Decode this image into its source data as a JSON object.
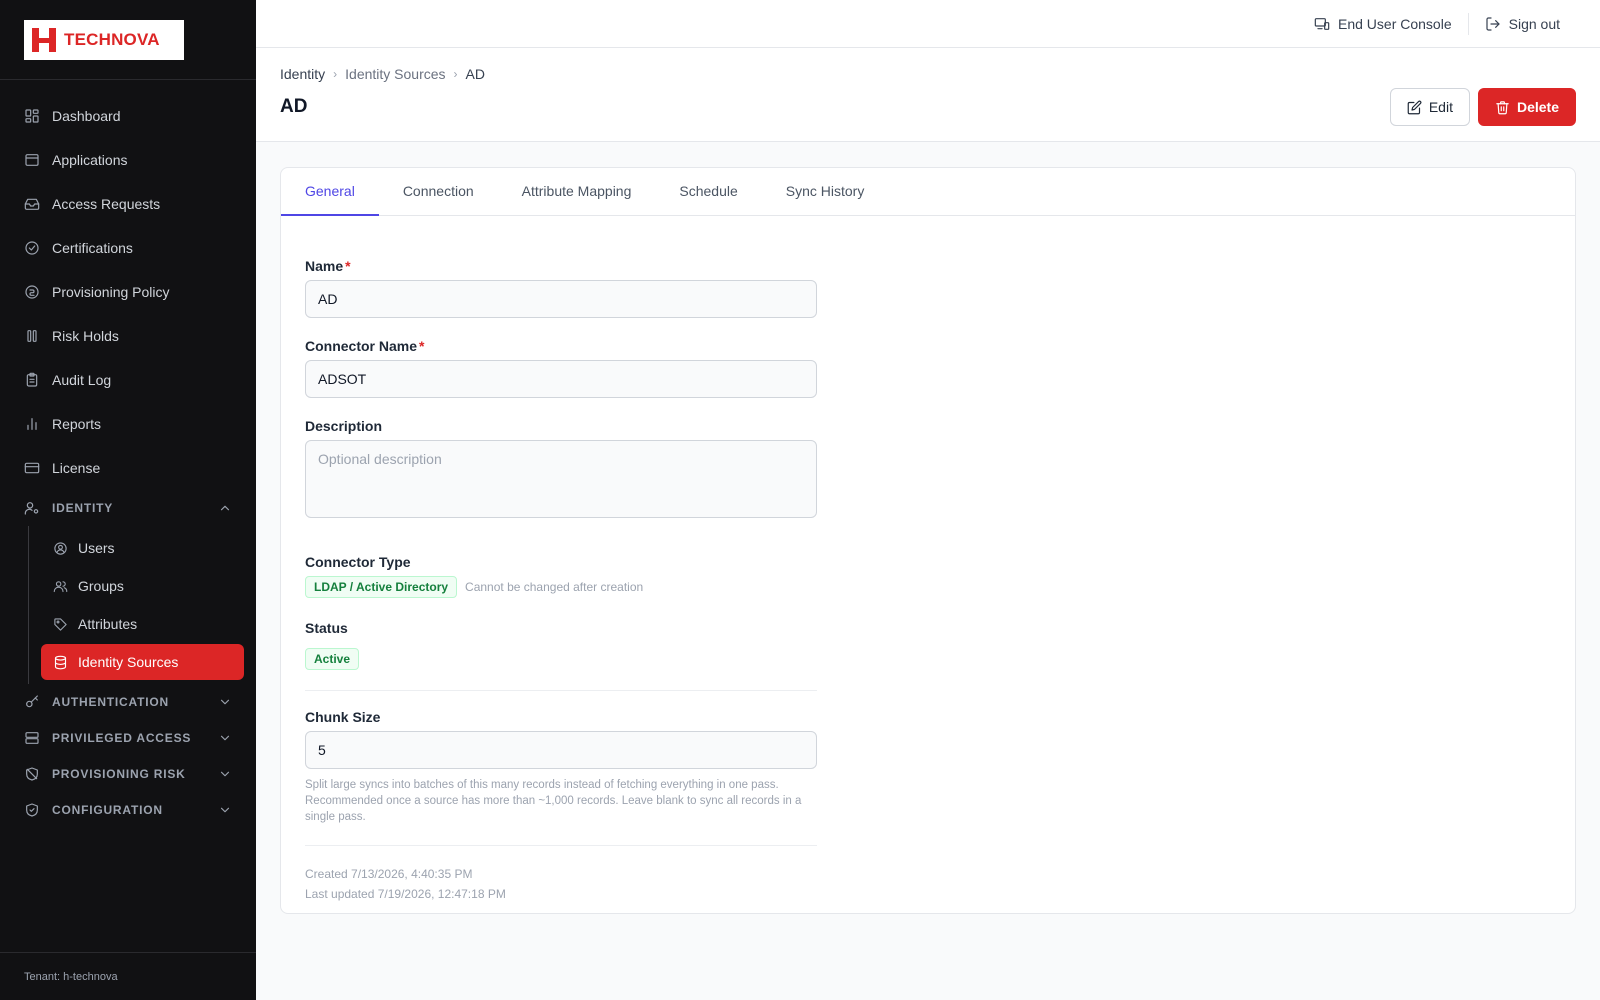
{
  "brand": {
    "name": "TECHNOVA",
    "accent": "#dc2626"
  },
  "sidebar": {
    "items": [
      {
        "label": "Dashboard",
        "icon": "dashboard-icon"
      },
      {
        "label": "Applications",
        "icon": "window-icon"
      },
      {
        "label": "Access Requests",
        "icon": "inbox-icon"
      },
      {
        "label": "Certifications",
        "icon": "check-circle-icon"
      },
      {
        "label": "Provisioning Policy",
        "icon": "policy-icon"
      },
      {
        "label": "Risk Holds",
        "icon": "pause-icon"
      },
      {
        "label": "Audit Log",
        "icon": "clipboard-icon"
      },
      {
        "label": "Reports",
        "icon": "bar-chart-icon"
      },
      {
        "label": "License",
        "icon": "card-icon"
      }
    ],
    "identity_section": {
      "label": "IDENTITY",
      "items": [
        {
          "label": "Users",
          "icon": "user-circle-icon"
        },
        {
          "label": "Groups",
          "icon": "users-icon"
        },
        {
          "label": "Attributes",
          "icon": "tag-icon"
        },
        {
          "label": "Identity Sources",
          "icon": "database-icon",
          "active": true
        }
      ]
    },
    "sections": [
      {
        "label": "AUTHENTICATION",
        "icon": "key-icon"
      },
      {
        "label": "PRIVILEGED ACCESS",
        "icon": "server-icon"
      },
      {
        "label": "PROVISIONING RISK",
        "icon": "shield-off-icon"
      },
      {
        "label": "CONFIGURATION",
        "icon": "shield-check-icon"
      }
    ],
    "tenant": "Tenant: h-technova"
  },
  "topbar": {
    "end_user_console": "End User Console",
    "sign_out": "Sign out"
  },
  "header": {
    "breadcrumb": [
      "Identity",
      "Identity Sources",
      "AD"
    ],
    "title": "AD",
    "edit_label": "Edit",
    "delete_label": "Delete"
  },
  "tabs": [
    "General",
    "Connection",
    "Attribute Mapping",
    "Schedule",
    "Sync History"
  ],
  "form": {
    "name_label": "Name",
    "name_value": "AD",
    "connector_name_label": "Connector Name",
    "connector_name_value": "ADSOT",
    "description_label": "Description",
    "description_placeholder": "Optional description",
    "connector_type_label": "Connector Type",
    "connector_type_value": "LDAP / Active Directory",
    "connector_type_hint": "Cannot be changed after creation",
    "status_label": "Status",
    "status_value": "Active",
    "chunk_size_label": "Chunk Size",
    "chunk_size_value": "5",
    "chunk_size_help": "Split large syncs into batches of this many records instead of fetching everything in one pass. Recommended once a source has more than ~1,000 records. Leave blank to sync all records in a single pass.",
    "created": "Created 7/13/2026, 4:40:35 PM",
    "updated": "Last updated 7/19/2026, 12:47:18 PM"
  }
}
